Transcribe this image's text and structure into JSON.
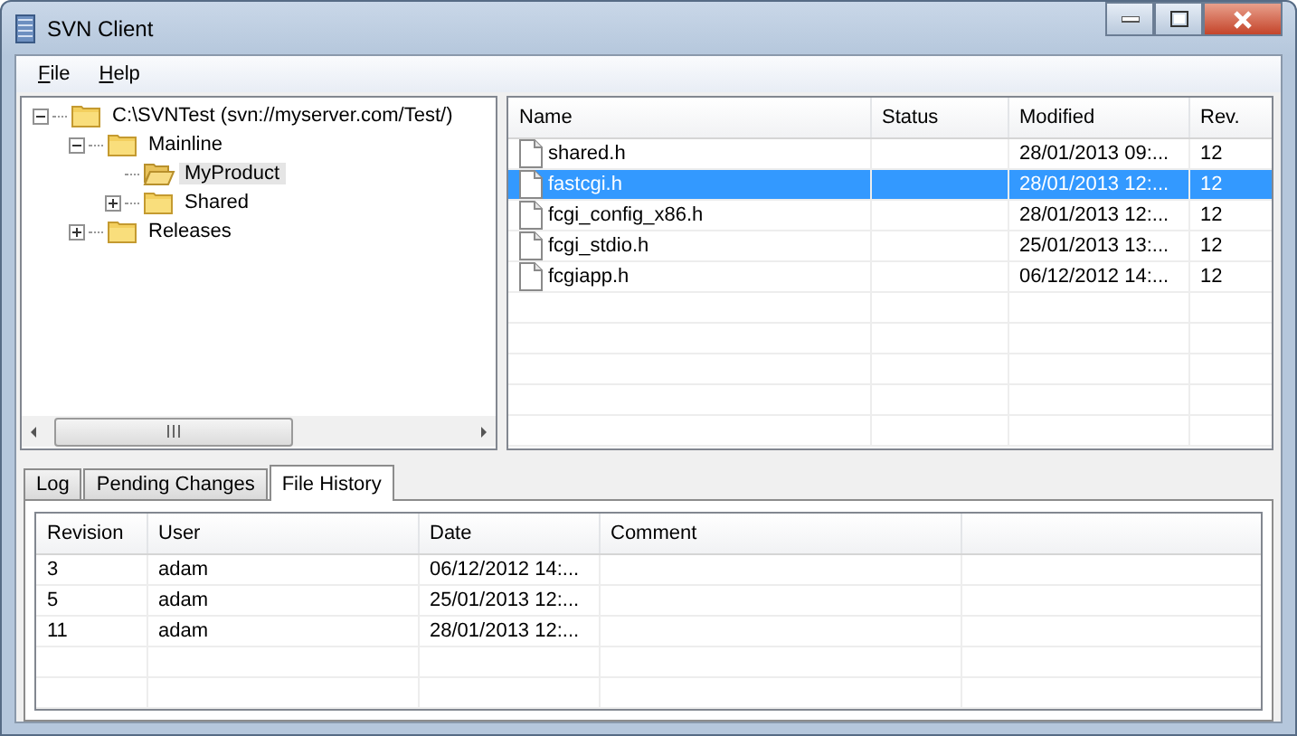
{
  "window": {
    "title": "SVN Client"
  },
  "menu": [
    "File",
    "Help"
  ],
  "tree": [
    {
      "label": "C:\\SVNTest (svn://myserver.com/Test/)",
      "expanded": true,
      "selected": false,
      "children": [
        {
          "label": "Mainline",
          "expanded": true,
          "selected": false,
          "children": [
            {
              "label": "MyProduct",
              "selected": true
            },
            {
              "label": "Shared",
              "expanded": false,
              "selected": false
            }
          ]
        },
        {
          "label": "Releases",
          "expanded": false,
          "selected": false
        }
      ]
    }
  ],
  "files": {
    "columns": [
      "Name",
      "Status",
      "Modified",
      "Rev."
    ],
    "rows": [
      {
        "name": "shared.h",
        "status": "",
        "modified": "28/01/2013 09:...",
        "rev": "12",
        "selected": false
      },
      {
        "name": "fastcgi.h",
        "status": "",
        "modified": "28/01/2013 12:...",
        "rev": "12",
        "selected": true
      },
      {
        "name": "fcgi_config_x86.h",
        "status": "",
        "modified": "28/01/2013 12:...",
        "rev": "12",
        "selected": false
      },
      {
        "name": "fcgi_stdio.h",
        "status": "",
        "modified": "25/01/2013 13:...",
        "rev": "12",
        "selected": false
      },
      {
        "name": "fcgiapp.h",
        "status": "",
        "modified": "06/12/2012 14:...",
        "rev": "12",
        "selected": false
      }
    ]
  },
  "tabs": [
    {
      "label": "Log",
      "selected": false
    },
    {
      "label": "Pending Changes",
      "selected": false
    },
    {
      "label": "File History",
      "selected": true
    }
  ],
  "history": {
    "columns": [
      "Revision",
      "User",
      "Date",
      "Comment"
    ],
    "rows": [
      {
        "revision": "3",
        "user": "adam",
        "date": "06/12/2012 14:..."
      },
      {
        "revision": "5",
        "user": "adam",
        "date": "25/01/2013 12:..."
      },
      {
        "revision": "11",
        "user": "adam",
        "date": "28/01/2013 12:..."
      }
    ]
  }
}
